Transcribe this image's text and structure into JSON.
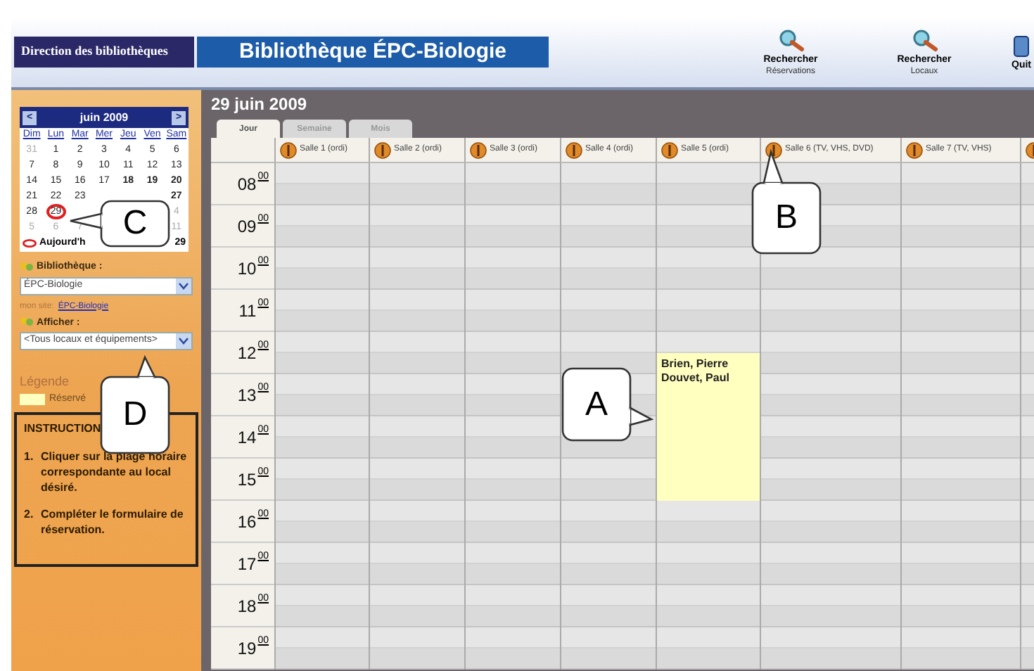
{
  "header": {
    "org": "Direction des bibliothèques",
    "title": "Bibliothèque ÉPC-Biologie",
    "actions": [
      {
        "title": "Rechercher",
        "subtitle": "Réservations"
      },
      {
        "title": "Rechercher",
        "subtitle": "Locaux"
      },
      {
        "title": "Quit"
      }
    ]
  },
  "sidebar": {
    "calendar": {
      "month": "juin 2009",
      "prev": "<",
      "next": ">",
      "weekdays": [
        "Dim",
        "Lun",
        "Mar",
        "Mer",
        "Jeu",
        "Ven",
        "Sam"
      ],
      "weeks": [
        {
          "days": [
            {
              "d": "31",
              "muted": true,
              "bold": false,
              "today": false
            },
            {
              "d": "1",
              "muted": false,
              "bold": false,
              "today": false
            },
            {
              "d": "2",
              "muted": false,
              "bold": false,
              "today": false
            },
            {
              "d": "3",
              "muted": false,
              "bold": false,
              "today": false
            },
            {
              "d": "4",
              "muted": false,
              "bold": false,
              "today": false
            },
            {
              "d": "5",
              "muted": false,
              "bold": false,
              "today": false
            },
            {
              "d": "6",
              "muted": false,
              "bold": false,
              "today": false
            }
          ]
        },
        {
          "days": [
            {
              "d": "7",
              "muted": false,
              "bold": false,
              "today": false
            },
            {
              "d": "8",
              "muted": false,
              "bold": false,
              "today": false
            },
            {
              "d": "9",
              "muted": false,
              "bold": false,
              "today": false
            },
            {
              "d": "10",
              "muted": false,
              "bold": false,
              "today": false
            },
            {
              "d": "11",
              "muted": false,
              "bold": false,
              "today": false
            },
            {
              "d": "12",
              "muted": false,
              "bold": false,
              "today": false
            },
            {
              "d": "13",
              "muted": false,
              "bold": false,
              "today": false
            }
          ]
        },
        {
          "days": [
            {
              "d": "14",
              "muted": false,
              "bold": false,
              "today": false
            },
            {
              "d": "15",
              "muted": false,
              "bold": false,
              "today": false
            },
            {
              "d": "16",
              "muted": false,
              "bold": false,
              "today": false
            },
            {
              "d": "17",
              "muted": false,
              "bold": false,
              "today": false
            },
            {
              "d": "18",
              "muted": false,
              "bold": true,
              "today": false
            },
            {
              "d": "19",
              "muted": false,
              "bold": true,
              "today": false
            },
            {
              "d": "20",
              "muted": false,
              "bold": true,
              "today": false
            }
          ]
        },
        {
          "days": [
            {
              "d": "21",
              "muted": false,
              "bold": false,
              "today": false
            },
            {
              "d": "22",
              "muted": false,
              "bold": false,
              "today": false
            },
            {
              "d": "23",
              "muted": false,
              "bold": false,
              "today": false
            }
          ],
          "end": [
            {
              "d": "27",
              "muted": false,
              "bold": true,
              "today": false
            }
          ]
        },
        {
          "days": [
            {
              "d": "28",
              "muted": false,
              "bold": false,
              "today": false
            },
            {
              "d": "29",
              "muted": false,
              "bold": false,
              "today": true
            }
          ],
          "end": [
            {
              "d": "4",
              "muted": true,
              "bold": false,
              "today": false
            }
          ]
        },
        {
          "days": [
            {
              "d": "5",
              "muted": true,
              "bold": false,
              "today": false
            },
            {
              "d": "6",
              "muted": true,
              "bold": false,
              "today": false
            },
            {
              "d": "7",
              "muted": true,
              "bold": false,
              "today": false
            }
          ],
          "end": [
            {
              "d": "11",
              "muted": true,
              "bold": false,
              "today": false
            }
          ]
        }
      ],
      "today_label": "Aujourd'h",
      "today_tail": "29"
    },
    "library": {
      "label": "Bibliothèque :",
      "value": "ÉPC-Biologie"
    },
    "my_site": {
      "label": "mon site:",
      "link": "ÉPC-Biologie"
    },
    "display": {
      "label": "Afficher :",
      "value": "<Tous locaux et équipements>"
    },
    "legend": {
      "title": "Légende",
      "items": [
        {
          "label": "Réservé",
          "color": "#ffffc0"
        }
      ]
    },
    "instructions": {
      "title": "INSTRUCTION",
      "steps": [
        {
          "num": "1.",
          "text": "Cliquer sur la plage horaire correspondante au local désiré."
        },
        {
          "num": "2.",
          "text": "Compléter le formulaire de réservation."
        }
      ]
    }
  },
  "schedule": {
    "date": "29 juin 2009",
    "tabs": [
      {
        "label": "Jour",
        "selected": true
      },
      {
        "label": "Semaine",
        "selected": false
      },
      {
        "label": "Mois",
        "selected": false
      }
    ],
    "rooms": [
      {
        "kind": "room",
        "name": "Salle 1 (ordi)"
      },
      {
        "kind": "room",
        "name": "Salle 2 (ordi)"
      },
      {
        "kind": "room",
        "name": "Salle 3 (ordi)"
      },
      {
        "kind": "room",
        "name": "Salle 4 (ordi)"
      },
      {
        "kind": "room",
        "name": "Salle 5 (ordi)",
        "reservations": [
          {
            "names": [
              "Brien, Pierre",
              "Douvet, Paul"
            ]
          }
        ]
      },
      {
        "kind": "room",
        "name": "Salle 6 (TV, VHS, DVD)"
      },
      {
        "kind": "room",
        "name": "Salle 7 (TV, VHS)"
      },
      {
        "kind": "icon_only"
      }
    ],
    "hours": [
      {
        "hour": "08",
        "minutes": "00"
      },
      {
        "hour": "09",
        "minutes": "00"
      },
      {
        "hour": "10",
        "minutes": "00"
      },
      {
        "hour": "11",
        "minutes": "00"
      },
      {
        "hour": "12",
        "minutes": "00"
      },
      {
        "hour": "13",
        "minutes": "00"
      },
      {
        "hour": "14",
        "minutes": "00"
      },
      {
        "hour": "15",
        "minutes": "00"
      },
      {
        "hour": "16",
        "minutes": "00"
      },
      {
        "hour": "17",
        "minutes": "00"
      },
      {
        "hour": "18",
        "minutes": "00"
      },
      {
        "hour": "19",
        "minutes": "00"
      }
    ]
  },
  "callouts": [
    {
      "letter": "C"
    },
    {
      "letter": "B"
    },
    {
      "letter": "D"
    },
    {
      "letter": "A"
    }
  ]
}
